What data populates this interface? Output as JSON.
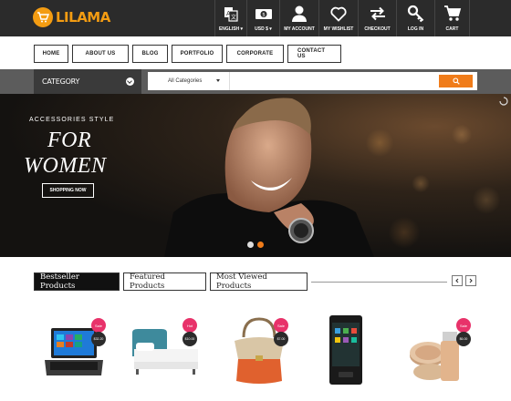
{
  "brand": {
    "name": "LILAMA",
    "accent": "#f39c12"
  },
  "top_nav": [
    {
      "label": "ENGLISH ▾",
      "icon": "language-icon"
    },
    {
      "label": "USD $ ▾",
      "icon": "currency-icon"
    },
    {
      "label": "MY ACCOUNT",
      "icon": "user-icon"
    },
    {
      "label": "MY WISHLIST",
      "icon": "heart-icon"
    },
    {
      "label": "CHECKOUT",
      "icon": "swap-arrows-icon"
    },
    {
      "label": "LOG IN",
      "icon": "key-icon"
    },
    {
      "label": "CART",
      "icon": "cart-icon"
    }
  ],
  "menu": [
    "HOME",
    "ABOUT US",
    "BLOG",
    "PORTFOLIO",
    "CORPORATE",
    "CONTACT US"
  ],
  "category": {
    "label": "CATEGORY"
  },
  "search": {
    "selected_category": "All Categories",
    "placeholder": "",
    "button_color": "#f07c1a"
  },
  "hero": {
    "subtitle": "ACCESSORIES STYLE",
    "title_line1": "FOR",
    "title_line2": "WOMEN",
    "button": "SHOPPING NOW",
    "slides": 2,
    "active_slide": 2
  },
  "tabs": [
    "Bestseller Products",
    "Featured Products",
    "Most Viewed Products"
  ],
  "active_tab": 0,
  "products": [
    {
      "badge": "Sale",
      "price": "$32.20",
      "name": ""
    },
    {
      "badge": "Hot",
      "price": "$10.00",
      "name": ""
    },
    {
      "badge": "Sale",
      "price": "$7.00",
      "name": ""
    },
    {
      "badge": "",
      "price": "",
      "name": ""
    },
    {
      "badge": "Sale",
      "price": "$6.00",
      "name": ""
    }
  ]
}
